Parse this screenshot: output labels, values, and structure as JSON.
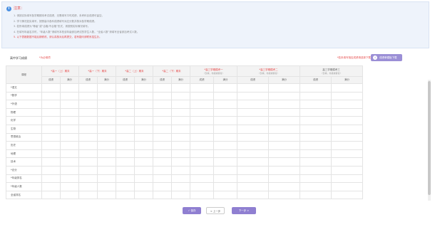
{
  "notice": {
    "icon": "info-icon",
    "title": "注意：",
    "items": [
      "1. 请按实际填写各学期期末考试成绩，无需填写平时成绩，未考科目成绩可留空。",
      "2. 学习情况如实填写，按照高中各科成绩填写对应分数并核对各学期成绩。",
      "3. 若所填成绩为“等级”或“合格/不合格”形式，请按照实际情况填写。",
      "4. 在填写年级名次时，“年级人数”请填写本校该年级参加考试的学生人数，“全省人数”请填写全省参加考试人数。",
      "5. 以下表格数据不能后期修改，请认真核对后再提交，若有疑问请联系招生办。"
    ]
  },
  "table_title": "高中学习成绩",
  "table_note": "*为必填项",
  "right_note": "*若未填写相应成绩请选择下载",
  "download_button": "成绩单模板下载",
  "header": {
    "subject": "课程",
    "semesters": [
      "*高一（上）期末",
      "*高一（下）期末",
      "*高二（上）期末",
      "*高二（下）期末",
      "*高三学期模考一",
      "*高三学期模考二",
      "高三学期模考三"
    ],
    "mock_sub": "（仅填，市级或者省）",
    "sub_cols": [
      "成绩",
      "满分"
    ]
  },
  "subjects": [
    "*语文",
    "*数学",
    "*外语",
    "物理",
    "化学",
    "生物",
    "思想政治",
    "历史",
    "地理",
    "技术",
    "*总分",
    "*年级排名",
    "*年级人数",
    "全省排名"
  ],
  "footer": {
    "save": "✓ 保存",
    "prev": "< 上一步",
    "next": "下一步 >"
  }
}
